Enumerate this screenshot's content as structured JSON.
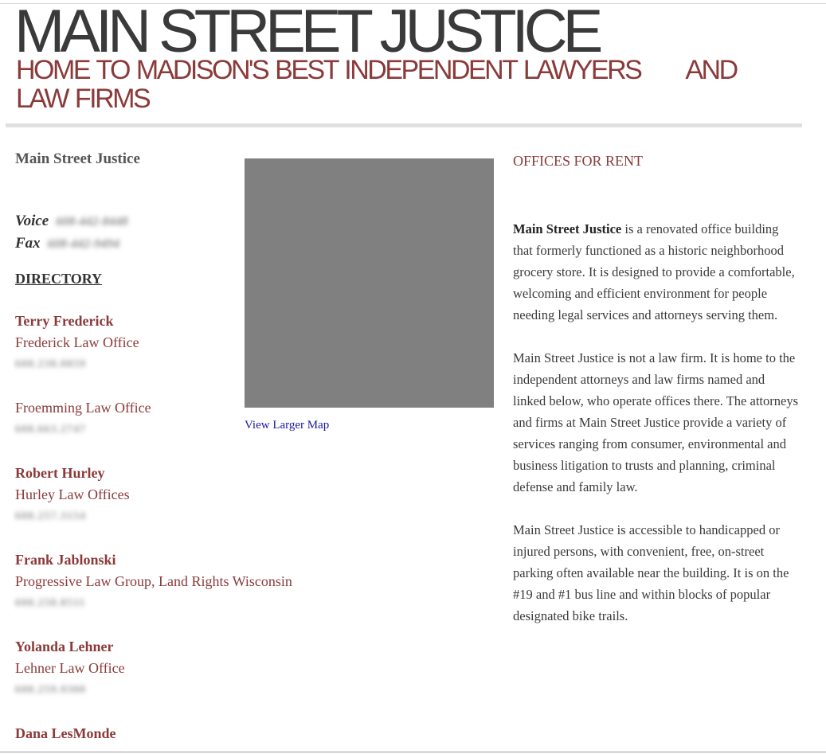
{
  "header": {
    "title": "MAIN STREET JUSTICE",
    "tagline_main": "HOME TO MADISON'S BEST INDEPENDENT LAWYERS",
    "tagline_and": "AND",
    "tagline_end": "LAW FIRMS"
  },
  "left": {
    "org_name": "Main Street Justice",
    "voice_label": "Voice",
    "voice_number": "608-442-8448",
    "fax_label": "Fax",
    "fax_number": "608-442-9494",
    "directory_heading": "DIRECTORY",
    "directory": [
      {
        "attorney": "Terry Frederick",
        "firm": "Frederick Law Office",
        "phone": "608.238.0859"
      },
      {
        "attorney": "",
        "firm": "Froemming Law Office",
        "phone": "608.663.2747"
      },
      {
        "attorney": "Robert Hurley",
        "firm": "Hurley Law Offices",
        "phone": "608.257.3154"
      },
      {
        "attorney": "Frank Jablonski",
        "firm": "Progressive Law Group, Land Rights Wisconsin",
        "phone": "608.258.8511"
      },
      {
        "attorney": "Yolanda Lehner",
        "firm": "Lehner Law Office",
        "phone": "608.259.9300"
      },
      {
        "attorney": "Dana LesMonde",
        "firm": "",
        "phone": ""
      }
    ]
  },
  "map": {
    "link_label": "View Larger Map"
  },
  "right": {
    "heading": "OFFICES FOR RENT",
    "p1_bold": "Main Street Justice",
    "p1_rest": " is a renovated office building that formerly functioned as a historic neighborhood grocery store.   It is designed to provide a comfortable, welcoming and efficient environment for people needing legal services and attorneys serving them.",
    "p2": "Main Street Justice is not a law firm. It is home to the independent attorneys and law firms named and linked below, who operate offices there.  The attorneys and firms at Main Street Justice provide a variety of services ranging from consumer, environmental and business litigation to trusts and planning, criminal defense and family law.",
    "p3": "Main Street Justice is accessible to handicapped or injured persons, with convenient, free, on-street parking often available near the building.  It is on the #19 and #1 bus line and within blocks of popular designated bike trails."
  },
  "colors": {
    "accent": "#8b3a3a",
    "title": "#3a3a3a",
    "map_placeholder": "#808080",
    "link": "#1a1aa6"
  }
}
